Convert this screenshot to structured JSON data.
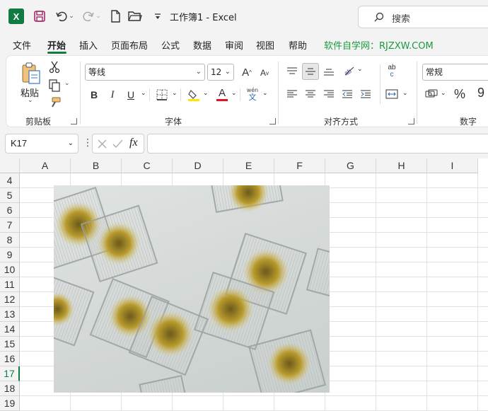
{
  "title_bar": {
    "app_logo": "X",
    "title": "工作簿1  -  Excel",
    "search_placeholder": "搜索",
    "icons": [
      "excel-logo-icon",
      "save-icon",
      "undo-icon",
      "redo-icon",
      "new-file-icon",
      "open-folder-icon",
      "customize-qat-icon",
      "search-icon"
    ]
  },
  "tabs": [
    {
      "label": "文件"
    },
    {
      "label": "开始",
      "active": true
    },
    {
      "label": "插入"
    },
    {
      "label": "页面布局"
    },
    {
      "label": "公式"
    },
    {
      "label": "数据"
    },
    {
      "label": "审阅"
    },
    {
      "label": "视图"
    },
    {
      "label": "帮助"
    },
    {
      "label": "软件自学网：RJZXW.COM"
    }
  ],
  "ribbon": {
    "clipboard": {
      "label": "剪贴板",
      "paste_label": "粘贴"
    },
    "font": {
      "label": "字体",
      "font_name": "等线",
      "font_size": "12",
      "bold": "B",
      "italic": "I",
      "underline": "U",
      "grow": "A",
      "shrink": "A",
      "font_color_letter": "A",
      "phonetic_top": "wén",
      "phonetic_bottom": "文",
      "font_color": "#e81123",
      "highlight_color": "#ffe600"
    },
    "alignment": {
      "label": "对齐方式",
      "wrap_top": "ab",
      "wrap_bottom": "c"
    },
    "number": {
      "label": "数字",
      "format": "常规",
      "percent": "%",
      "comma": "9"
    }
  },
  "formula_bar": {
    "name_box": "K17",
    "fx": "fx",
    "formula": ""
  },
  "sheet": {
    "columns": [
      "A",
      "B",
      "C",
      "D",
      "E",
      "F",
      "G",
      "H",
      "I"
    ],
    "rows": [
      "4",
      "5",
      "6",
      "7",
      "8",
      "9",
      "10",
      "11",
      "12",
      "13",
      "14",
      "15",
      "16",
      "17",
      "18",
      "19"
    ],
    "active_row": "17",
    "accent": "#107c41"
  }
}
